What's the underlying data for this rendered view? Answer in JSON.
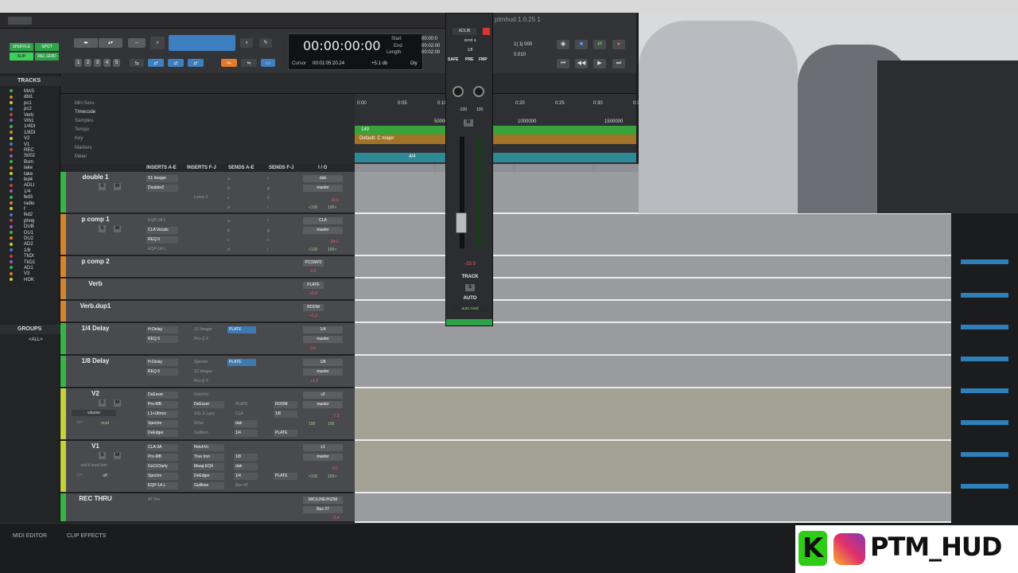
{
  "menubar": {
    "apple_glyph": ""
  },
  "edit_modes": {
    "shuffle": "SHUFFLE",
    "spot": "SPOT",
    "slip": "SLIP",
    "grid": "REL GRID"
  },
  "grid_numbers": [
    "1",
    "2",
    "3",
    "4",
    "5"
  ],
  "counter": {
    "main": "00:00:00:00",
    "start_label": "Start",
    "end_label": "End",
    "length_label": "Length",
    "start": "00:00:0",
    "end": "00:02:00",
    "length": "00:02:00",
    "cursor_label": "Cursor",
    "cursor_value": "00:01:05:20.24",
    "db_value": "+5.1 db",
    "dly": "Dly"
  },
  "hud_title": "ptmhud 1.0.25 1",
  "transport": {
    "bar_value": "1| 1| 000",
    "tempo_value": "0.010"
  },
  "tracks_panel": {
    "header": "TRACKS",
    "items": [
      "MAS",
      "dbl1",
      "pc1",
      "pc2",
      "Verb",
      "Vrb1",
      "1/4DI",
      "1/8DI",
      "V2",
      "V1",
      "REC",
      "S002",
      "Bsm",
      "lake",
      "take",
      "lkd4",
      "ADLI",
      "1/4",
      "lkd3",
      "radio",
      "f",
      "lkd2",
      "phnq",
      "DUB",
      "DU1",
      "DU2",
      "AD2",
      "1/8",
      "TkDt",
      "TkD1",
      "AD1",
      "V3",
      "HOK"
    ],
    "groups_header": "GROUPS",
    "groups_item": "<ALL>"
  },
  "rulers": [
    "Min:Secs",
    "Timecode",
    "Samples",
    "Tempo",
    "Key",
    "Markers",
    "Meter"
  ],
  "timeline": {
    "ticks": [
      "0:00",
      "0:05",
      "0:10",
      "0:15",
      "0:20",
      "0:25",
      "0:30",
      "0:35"
    ],
    "samples": [
      "500000",
      "1000000",
      "1500000"
    ],
    "tempo_value": "149",
    "key_label": "Default: C major",
    "meter_value": "4/4"
  },
  "column_headers": [
    "INSERTS A-E",
    "INSERTS F-J",
    "SENDS A-E",
    "SENDS F-J",
    "I / O"
  ],
  "tracks": [
    {
      "name": "double 1",
      "color": "#38b449",
      "inserts": [
        "S1 Imager",
        "Doubler2",
        ""
      ],
      "inserts_fj": [
        "",
        "",
        "Lossy 3"
      ],
      "sends": [
        "a",
        "b",
        "c",
        "d"
      ],
      "sends_fj": [
        "f",
        "g",
        "h",
        "i"
      ],
      "io_in": "dub",
      "io_out": "master",
      "vol": "+0.0",
      "pan_l": "<100",
      "pan_r": "100>"
    },
    {
      "name": "p comp 1",
      "color": "#d4842b",
      "inserts": [
        "EQP-1A L",
        "CLA Vocals",
        "REQ 6",
        "EQP-1A L"
      ],
      "sends": [
        "a",
        "b",
        "c",
        "d"
      ],
      "sends_fj": [
        "f",
        "g",
        "h",
        "i"
      ],
      "io_in": "CLA",
      "io_out": "master",
      "vol": "-34.1",
      "pan_l": "<100",
      "pan_r": "100>"
    },
    {
      "name": "p comp 2",
      "color": "#d4842b",
      "io_in": "PCOMP2",
      "io_out": "mastr",
      "vol": "0.0"
    },
    {
      "name": "Verb",
      "color": "#d4842b",
      "io_in": "PLATE",
      "io_out": "mastr",
      "vol": "+0.0"
    },
    {
      "name": "Verb.dup1",
      "color": "#d4842b",
      "io_in": "ROOM",
      "io_out": "mastr",
      "vol": "+1.2"
    },
    {
      "name": "1/4 Delay",
      "color": "#38b449",
      "inserts": [
        "H-Delay",
        "REQ 6"
      ],
      "inserts_fj": [
        "S1 Imager",
        "Pro-Q 3"
      ],
      "send_a": "PLATE",
      "io_in": "1/4",
      "io_out": "master",
      "vol": "0.0"
    },
    {
      "name": "1/8 Delay",
      "color": "#38b449",
      "inserts": [
        "H-Delay",
        "REQ 6"
      ],
      "inserts_fj": [
        "Spectre",
        "S1 Imager",
        "Pro-Q 3"
      ],
      "send_a": "PLATE",
      "io_in": "1/8",
      "io_out": "master",
      "vol": "+1.3"
    },
    {
      "name": "V2",
      "color": "#c3d13b",
      "inserts": [
        "DeEsser",
        "Pro-MB",
        "L1+Ultrmx",
        "Spectre",
        "DeEdger"
      ],
      "inserts_fj": [
        "NvtchVc",
        "DeEsser",
        "SSL E Lgcy",
        "RVox",
        "Gullfoss"
      ],
      "sends_row": [
        "PLATE",
        "CLA",
        "dub",
        "1/4"
      ],
      "sends_fj_row": [
        "ROOM",
        "1/8",
        "PLATE"
      ],
      "io_in": "v2",
      "io_out": "master",
      "vol": "-7.2",
      "pan_l": "100",
      "pan_r": "100",
      "auto": "volume",
      "auto_mode": "read",
      "dyn": "dyn"
    },
    {
      "name": "V1",
      "color": "#c3d13b",
      "inserts": [
        "CLA-3A",
        "Pro-MB",
        "Gs11Clarty",
        "Spectre",
        "EQP-1A L"
      ],
      "inserts_fj": [
        "NvtchVc",
        "True Iron",
        "Maag EQ4",
        "DeEdger",
        "Gullfoss"
      ],
      "sends_row": [
        "1/8",
        "dub",
        "1/4",
        "Bus 45"
      ],
      "sends_fj_row": [
        "PLATE"
      ],
      "io_in": "v1",
      "io_out": "master",
      "vol": "0.0",
      "pan_l": "<100",
      "pan_r": "100>",
      "auto": "snd b level trim",
      "auto_mode": "off",
      "dyn": "dyn"
    },
    {
      "name": "REC THRU",
      "color": "#38b449",
      "inserts": [
        "AT Pro"
      ],
      "io_in": "MIC/LINE/HIZ/M",
      "io_out": "Bus 27",
      "vol": "-0.4"
    }
  ],
  "mixer_strip": {
    "insert_name": "ADLIB",
    "send_label": "send a",
    "io": "1/8",
    "safe": "SAFE",
    "pre": "PRE",
    "fmp": "FMP",
    "pan_l": "-100",
    "pan_r": "100",
    "m": "M",
    "vol": "-33.9",
    "track_label": "TRACK",
    "s": "S",
    "auto_label": "AUTO",
    "auto_mode": "auto read"
  },
  "bottom_tabs": [
    "MIDI EDITOR",
    "CLIP EFFECTS"
  ],
  "logo": {
    "k": "K",
    "text": "PTM_HUD"
  },
  "colors": {
    "accent_blue": "#3e7ab0",
    "tempo_green": "#37a33a",
    "key_orange": "#a07328",
    "meter_teal": "#2f8a98"
  }
}
